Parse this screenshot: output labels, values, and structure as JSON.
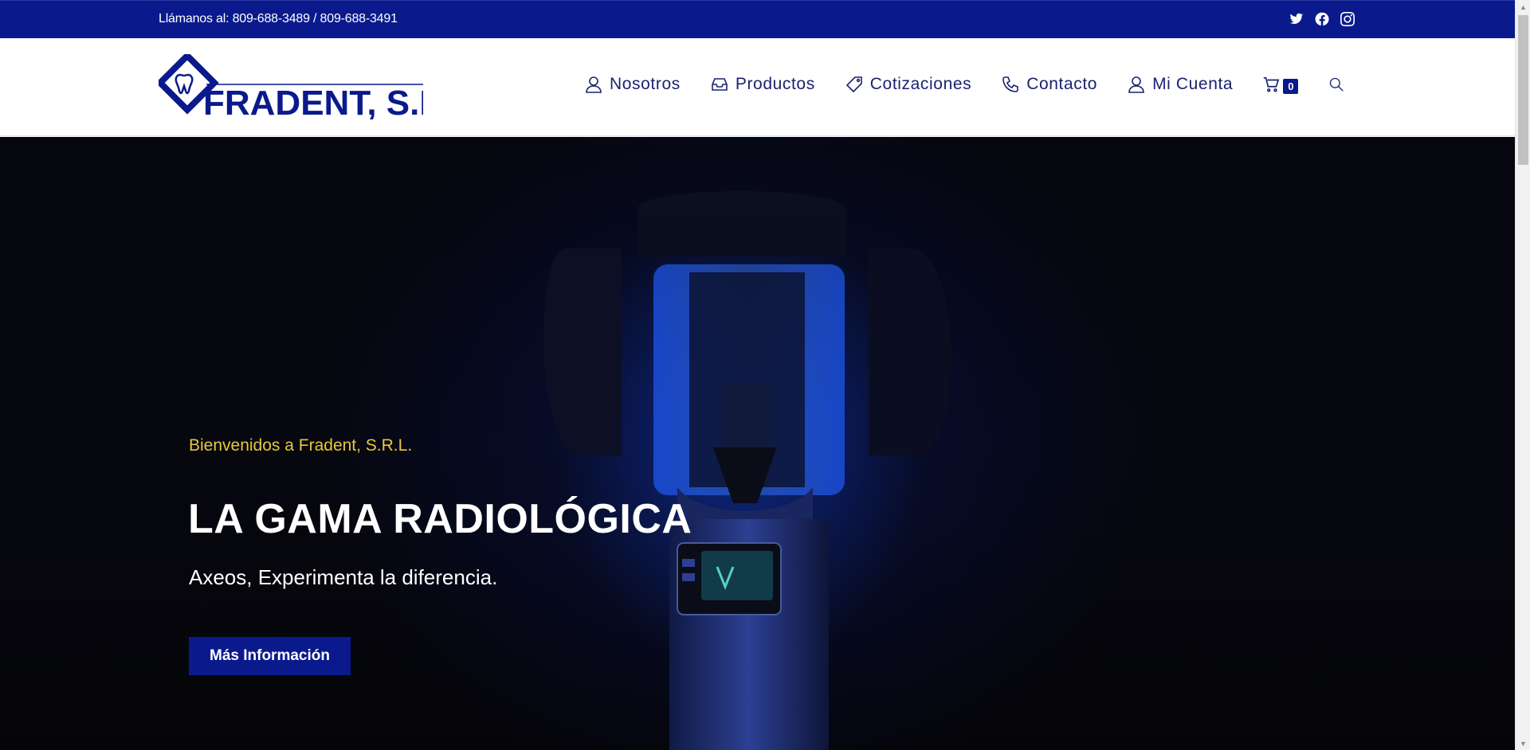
{
  "topbar": {
    "phone": "Llámanos al: 809-688-3489 / 809-688-3491",
    "social_icons": [
      "twitter-icon",
      "facebook-icon",
      "instagram-icon"
    ]
  },
  "header": {
    "logo_text": "FRADENT, S.R.L.",
    "nav": [
      {
        "label": "Nosotros",
        "icon": "user-icon"
      },
      {
        "label": "Productos",
        "icon": "inbox-icon"
      },
      {
        "label": "Cotizaciones",
        "icon": "tag-icon"
      },
      {
        "label": "Contacto",
        "icon": "phone-icon"
      },
      {
        "label": "Mi Cuenta",
        "icon": "user-icon"
      }
    ],
    "cart_count": "0",
    "search_icon": "search-icon"
  },
  "hero": {
    "welcome": "Bienvenidos a Fradent, S.R.L.",
    "headline": "LA GAMA RADIOLÓGICA",
    "subtitle": "Axeos, Experimenta la diferencia.",
    "cta_label": "Más Información"
  },
  "colors": {
    "brand_blue": "#0a1a8c",
    "nav_text": "#1a2270",
    "welcome_yellow": "#e8c83a"
  }
}
